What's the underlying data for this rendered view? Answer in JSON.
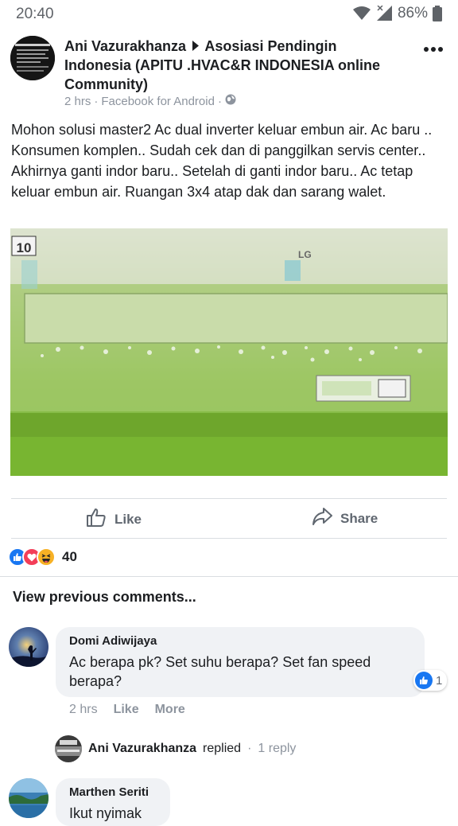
{
  "status_bar": {
    "time": "20:40",
    "battery": "86%"
  },
  "post": {
    "author": "Ani Vazurakhanza",
    "group": "Asosiasi Pendingin Indonesia (APITU .HVAC&R INDONESIA online Community)",
    "time": "2 hrs",
    "separator": "·",
    "source": "Facebook for Android",
    "text": "Mohon solusi master2 Ac dual inverter keluar embun air. Ac baru .. Konsumen komplen.. Sudah cek dan di panggilkan servis center.. Akhirnya ganti indor baru.. Setelah di ganti indor baru.. Ac tetap keluar embun air. Ruangan 3x4 atap dak dan sarang walet.",
    "photo_labels": {
      "badge": "10",
      "brand": "LG"
    }
  },
  "actions": {
    "like_label": "Like",
    "share_label": "Share"
  },
  "reactions": {
    "count": "40",
    "types": [
      "like",
      "love",
      "haha"
    ]
  },
  "comments_header": "View previous comments...",
  "comments": [
    {
      "name": "Domi Adiwijaya",
      "text": "Ac berapa pk? Set suhu berapa? Set fan speed berapa?",
      "time": "2 hrs",
      "like_label": "Like",
      "more_label": "More",
      "likes": "1"
    },
    {
      "name": "Marthen Seriti",
      "text": "Ikut nyimak"
    }
  ],
  "reply": {
    "name": "Ani Vazurakhanza",
    "verb": "replied",
    "separator": "·",
    "count": "1 reply"
  },
  "colors": {
    "facebook_blue": "#1877f2",
    "love_red": "#f33e58",
    "haha_yellow": "#f7b125",
    "meta_gray": "#8d949e",
    "photo_green": "#6fb52c"
  }
}
